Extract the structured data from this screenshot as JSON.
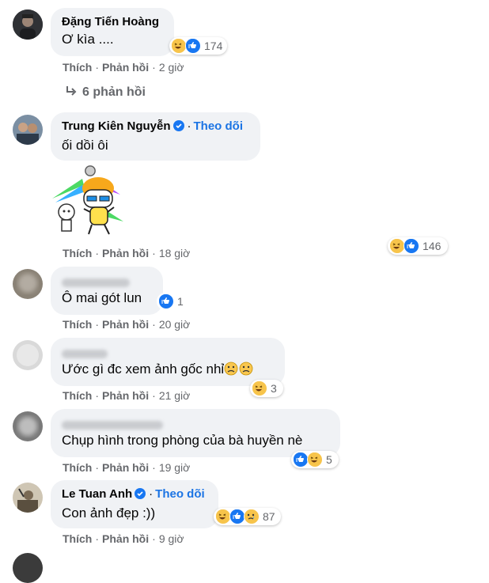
{
  "comments": [
    {
      "name": "Đặng Tiến Hoàng",
      "text": "Ơ kìa ....",
      "like": "Thích",
      "reply": "Phản hồi",
      "time": "2 giờ",
      "react_count": "174"
    },
    {
      "name": "Trung Kiên Nguyễn",
      "follow": "Theo dõi",
      "text": "ối dồi ôi",
      "like": "Thích",
      "reply": "Phản hồi",
      "time": "18 giờ",
      "react_count": "146"
    },
    {
      "text": "Ô mai gót lun",
      "like": "Thích",
      "reply": "Phản hồi",
      "time": "20 giờ",
      "react_count": "1"
    },
    {
      "text": "Ước gì đc xem ảnh gốc nhỉ",
      "like": "Thích",
      "reply": "Phản hồi",
      "time": "21 giờ",
      "react_count": "3"
    },
    {
      "text": "Chụp hình trong phòng của bà huyền nè",
      "like": "Thích",
      "reply": "Phản hồi",
      "time": "19 giờ",
      "react_count": "5"
    },
    {
      "name": "Le Tuan Anh",
      "follow": "Theo dõi",
      "text": "Con ảnh đẹp :))",
      "like": "Thích",
      "reply": "Phản hồi",
      "time": "9 giờ",
      "react_count": "87"
    }
  ],
  "replies_link": "6 phản hồi",
  "separator": "·",
  "colors": {
    "bubble": "#f0f2f5",
    "link": "#1b74e4",
    "meta": "#65676b",
    "like": "#1877f2",
    "haha": "#f7c44b"
  },
  "icons": [
    "verified-badge-icon",
    "like-reaction-icon",
    "haha-reaction-icon",
    "sad-reaction-icon",
    "reply-arrow-icon",
    "frown-emoji-icon"
  ]
}
